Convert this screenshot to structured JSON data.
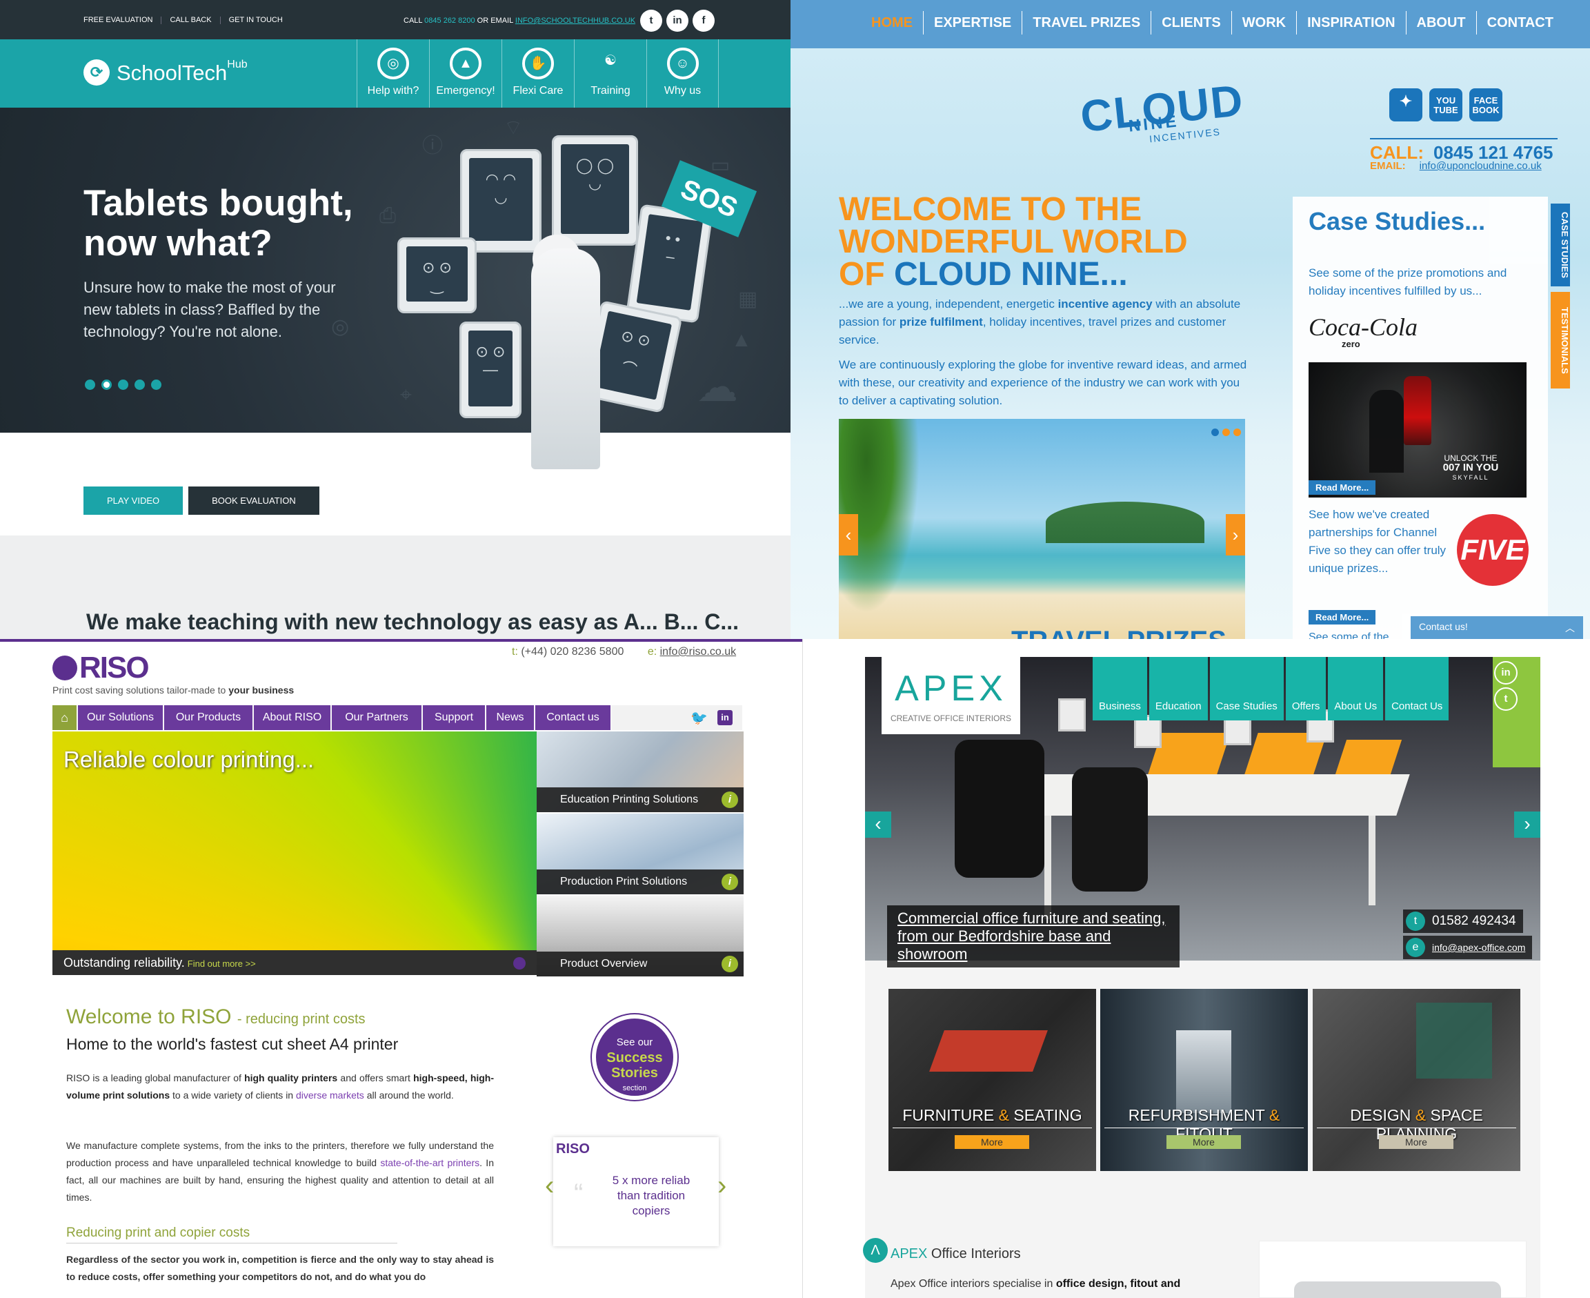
{
  "schooltech": {
    "top_links": [
      "FREE EVALUATION",
      "CALL BACK",
      "GET IN TOUCH"
    ],
    "contact_prefix": "CALL",
    "phone": "0845 262 8200",
    "contact_mid": "OR EMAIL",
    "email": "INFO@SCHOOLTECHHUB.CO.UK",
    "social": [
      "twitter-icon",
      "linkedin-icon",
      "facebook-icon"
    ],
    "logo": "SchoolTech",
    "logo_sup": "Hub",
    "nav": [
      "Help with?",
      "Emergency!",
      "Flexi Care",
      "Training",
      "Why us"
    ],
    "hero_title": "Tablets bought, now what?",
    "hero_text": "Unsure how to make the most of your new tablets in class? Baffled by the technology? You're not alone.",
    "sos": "SOS",
    "btn_play": "PLAY VIDEO",
    "btn_book": "BOOK EVALUATION",
    "tagline": "We make teaching with new technology as easy as A... B... C...",
    "colors": {
      "teal": "#1ba4a8",
      "dark": "#263238"
    }
  },
  "cloudnine": {
    "nav": [
      "HOME",
      "EXPERTISE",
      "TRAVEL PRIZES",
      "CLIENTS",
      "WORK",
      "INSPIRATION",
      "ABOUT",
      "CONTACT"
    ],
    "logo_main": "CLOUD",
    "logo_sub": "NINE",
    "logo_small": "INCENTIVES",
    "social": [
      "twitter-icon",
      "YOU TUBE",
      "FACE BOOK"
    ],
    "call_label": "CALL:",
    "phone": "0845 121 4765",
    "email_label": "EMAIL:",
    "email": "info@uponcloudnine.co.uk",
    "h1_line1": "WELCOME TO THE",
    "h1_line2": "WONDERFUL WORLD",
    "h1_line3a": "OF",
    "h1_line3b": "CLOUD NINE...",
    "p1_a": "...we are a young, independent, energetic",
    "p1_b": "incentive agency",
    "p1_c": "with an absolute passion for",
    "p1_d": "prize fulfilment",
    "p1_e": ", holiday incentives, travel prizes and customer service.",
    "p2": "We are continuously exploring the globe for inventive reward ideas, and armed with these, our creativity and experience of the industry we can work with you to deliver a captivating solution.",
    "slider_caption": "TRAVEL PRIZES",
    "side_title": "Case Studies...",
    "side_text": "See some of the prize promotions and holiday incentives fulfilled by us...",
    "coke": "Coca-Cola",
    "coke_sub": "zero",
    "bond_line1": "UNLOCK THE",
    "bond_line2": "007 IN YOU",
    "bond_line3": "SKYFALL",
    "read_more": "Read More...",
    "five_text": "See how we've created partnerships for Channel Five so they can offer truly unique prizes...",
    "five_logo": "FIVE",
    "side_more": "See some of the",
    "tab_case": "CASE STUDIES",
    "tab_test": "TESTIMONIALS",
    "contact_widget": "Contact us!",
    "colors": {
      "orange": "#f7941d",
      "blue": "#1b75bb"
    }
  },
  "riso": {
    "logo": "RISO",
    "tagline_a": "Print cost saving solutions tailor-made to",
    "tagline_b": "your business",
    "tel_label": "t:",
    "tel": "(+44) 020 8236 5800",
    "email_label": "e:",
    "email": "info@riso.co.uk",
    "nav": [
      "Our Solutions",
      "Our Products",
      "About RISO",
      "Our Partners",
      "Support",
      "News",
      "Contact us"
    ],
    "slide_title": "Reliable colour printing...",
    "slide_caption": "Outstanding reliability.",
    "slide_link": "Find out more >>",
    "thumbs": [
      "Education Printing Solutions",
      "Production Print Solutions",
      "Product Overview"
    ],
    "welcome": "Welcome to RISO",
    "welcome_sub": "- reducing print costs",
    "subhead": "Home to the world's fastest cut sheet A4 printer",
    "p1_a": "RISO is a leading global manufacturer of",
    "p1_b": "high quality printers",
    "p1_c": "and offers smart",
    "p1_d": "high-speed, high-volume print solutions",
    "p1_e": "to a wide variety of clients in",
    "p1_f": "diverse markets",
    "p1_g": "all around the world.",
    "p2_a": "We manufacture complete systems, from the inks to the printers, therefore we fully understand the production process and have unparalleled technical knowledge to build",
    "p2_b": "state-of-the-art printers",
    "p2_c": ". In fact, all our machines are built by hand, ensuring the highest quality and attention to detail at all times.",
    "h3": "Reducing print and copier costs",
    "p3": "Regardless of the sector you work in, competition is fierce and the only way to stay ahead is to reduce costs, offer something your competitors do not, and do what you do",
    "badge_a": "See our",
    "badge_b1": "Success",
    "badge_b2": "Stories",
    "badge_c": "section",
    "quote_logo": "RISO",
    "quote": "5 x more reliab than tradition copiers",
    "colors": {
      "purple": "#5b2f8e",
      "green": "#8fa33a"
    }
  },
  "apex": {
    "logo": "APEX",
    "logo_sub": "CREATIVE OFFICE INTERIORS",
    "nav": [
      "Business",
      "Education",
      "Case Studies",
      "Offers",
      "About Us",
      "Contact Us"
    ],
    "social": [
      "linkedin-icon",
      "twitter-icon"
    ],
    "caption": "Commercial office furniture and seating, from our Bedfordshire base and showroom",
    "tel_icon": "t",
    "tel": "01582 492434",
    "email_icon": "e",
    "email": "info@apex-office.com",
    "tiles": [
      {
        "a": "FURNITURE",
        "amp": "&",
        "b": "SEATING",
        "more": "More",
        "more_color": "#f8a31b"
      },
      {
        "a": "REFURBISHMENT",
        "amp": "&",
        "b": "FITOUT",
        "more": "More",
        "more_color": "#a8c66c"
      },
      {
        "a": "DESIGN",
        "amp": "&",
        "b": "SPACE PLANNING",
        "more": "More",
        "more_color": "#c9c2ad"
      }
    ],
    "about_a": "APEX",
    "about_b": "Office Interiors",
    "text_a": "Apex Office interiors specialise in",
    "text_b": "office design, fitout and",
    "colors": {
      "teal": "#18a59c",
      "orange": "#f8a31b"
    }
  }
}
